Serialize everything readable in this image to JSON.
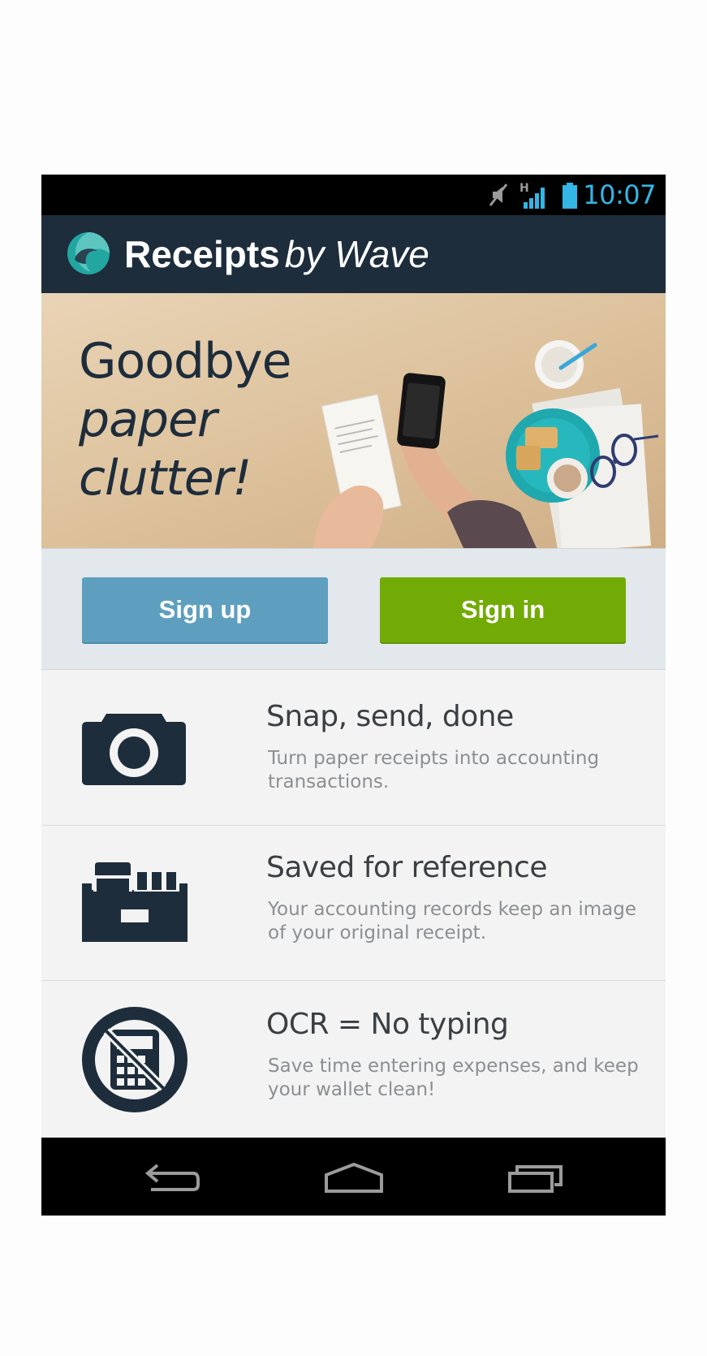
{
  "status_bar": {
    "time": "10:07",
    "network_label": "H",
    "icons": [
      "mute-icon",
      "signal-icon",
      "battery-icon"
    ],
    "time_color": "#33b5e5"
  },
  "app_bar": {
    "title_bold": "Receipts",
    "title_italic": "by Wave",
    "logo_icon": "wave-logo-icon",
    "background": "#1e2d3c"
  },
  "hero": {
    "line1": "Goodbye",
    "line2": "paper",
    "line3": "clutter!"
  },
  "actions": {
    "signup_label": "Sign up",
    "signin_label": "Sign in",
    "signup_color": "#5e9fbf",
    "signin_color": "#72ab06"
  },
  "features": [
    {
      "icon": "camera-icon",
      "title": "Snap, send, done",
      "description": "Turn paper receipts into accounting transactions."
    },
    {
      "icon": "file-box-icon",
      "title": "Saved for reference",
      "description": "Your accounting records keep an image of your original receipt."
    },
    {
      "icon": "no-calculator-icon",
      "title": "OCR = No typing",
      "description": "Save time entering expenses, and keep your wallet clean!"
    }
  ],
  "nav_bar": {
    "buttons": [
      "back-icon",
      "home-icon",
      "recents-icon"
    ]
  }
}
